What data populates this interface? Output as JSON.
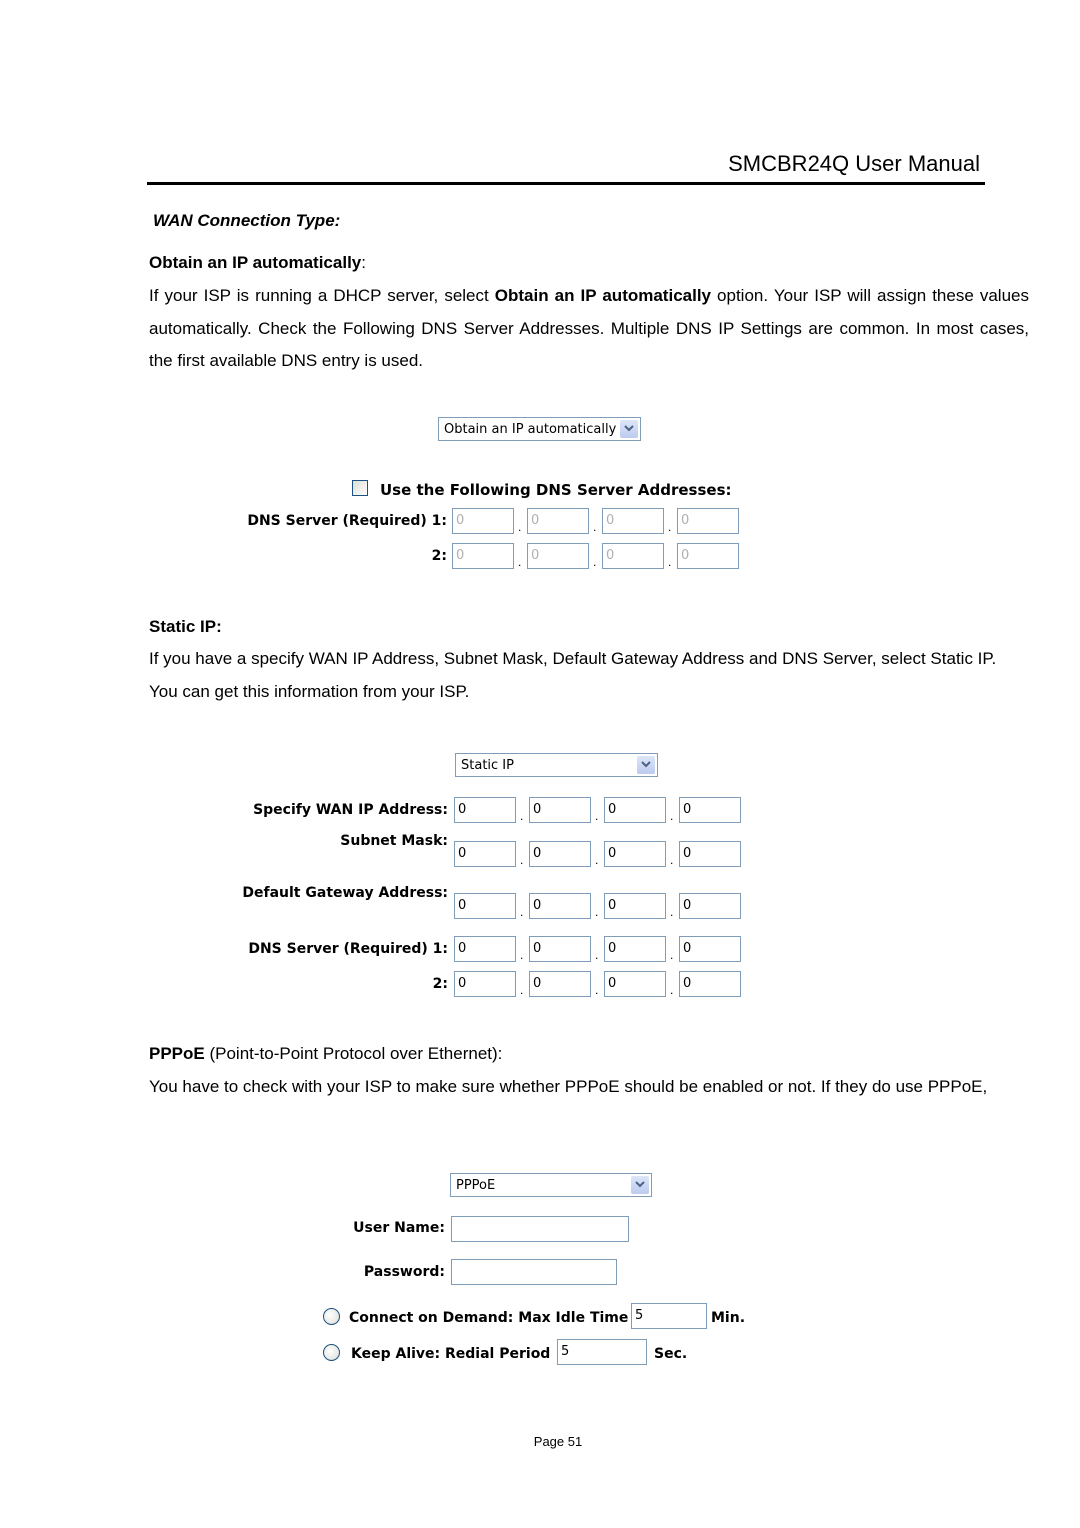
{
  "header": {
    "title": "SMCBR24Q User Manual"
  },
  "section_title": "WAN Connection Type:",
  "obtain": {
    "heading": "Obtain an IP automatically",
    "heading_suffix": ":",
    "para_1": "If your ISP is running a DHCP server, select ",
    "para_bold": "Obtain an IP automatically",
    "para_2": " option. Your ISP will assign these values automatically. Check the Following DNS Server Addresses. Multiple DNS IP Settings are common. In most cases, the first available DNS entry is used.",
    "select_value": "Obtain an IP automatically",
    "checkbox_label": "Use the Following DNS Server Addresses:",
    "checkbox_checked": false,
    "dns1_label": "DNS Server (Required) 1:",
    "dns2_label": "2:",
    "dns1": [
      "0",
      "0",
      "0",
      "0"
    ],
    "dns2": [
      "0",
      "0",
      "0",
      "0"
    ]
  },
  "static": {
    "heading": "Static IP:",
    "para": "If you have a specify WAN IP Address, Subnet Mask, Default Gateway Address and DNS Server, select Static IP. You can get this information from your ISP.",
    "select_value": "Static IP",
    "wan_label": "Specify WAN IP Address:",
    "mask_label": "Subnet Mask:",
    "gw_label": "Default Gateway Address:",
    "dns1_label": "DNS Server (Required) 1:",
    "dns2_label": "2:",
    "wan": [
      "0",
      "0",
      "0",
      "0"
    ],
    "mask": [
      "0",
      "0",
      "0",
      "0"
    ],
    "gw": [
      "0",
      "0",
      "0",
      "0"
    ],
    "dns1": [
      "0",
      "0",
      "0",
      "0"
    ],
    "dns2": [
      "0",
      "0",
      "0",
      "0"
    ]
  },
  "pppoe": {
    "heading_bold": "PPPoE",
    "heading_rest": " (Point-to-Point Protocol over Ethernet):",
    "para": "You have to check with your ISP to make sure whether PPPoE should be enabled or not. If they do use PPPoE,",
    "select_value": "PPPoE",
    "user_label": "User Name:",
    "user_value": "",
    "pass_label": "Password:",
    "pass_value": "",
    "cod_label": "Connect on Demand: Max Idle Time",
    "cod_value": "5",
    "cod_unit": "Min.",
    "ka_label": "Keep Alive: Redial Period",
    "ka_value": "5",
    "ka_unit": "Sec."
  },
  "dot": ".",
  "footer": {
    "page": "Page 51"
  }
}
